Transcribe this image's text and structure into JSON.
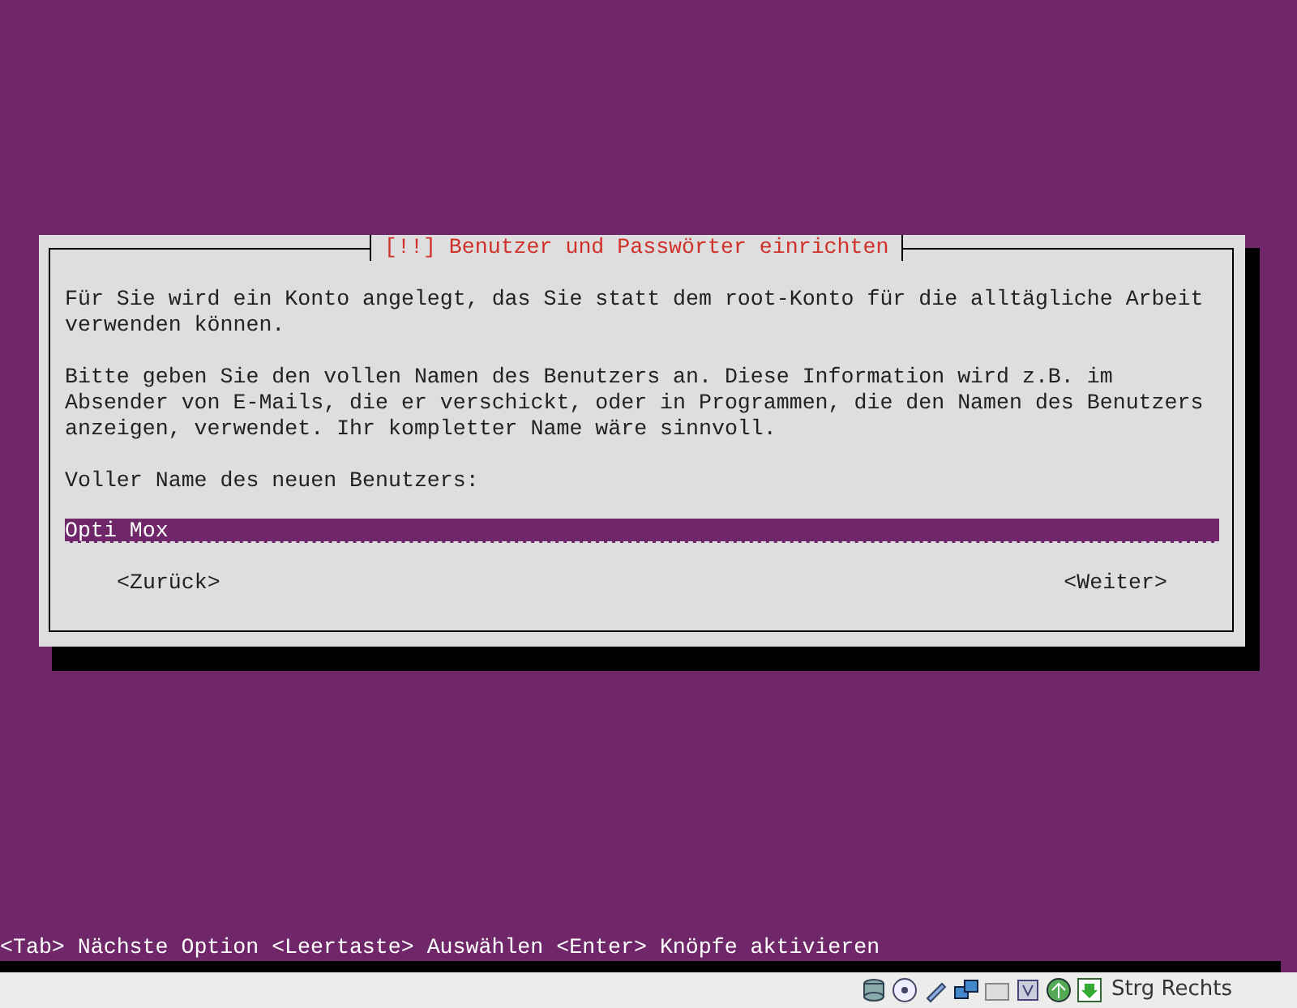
{
  "dialog": {
    "title": "[!!] Benutzer und Passwörter einrichten",
    "paragraphs": [
      "Für Sie wird ein Konto angelegt, das Sie statt dem root-Konto für die alltägliche Arbeit verwenden können.",
      "Bitte geben Sie den vollen Namen des Benutzers an. Diese Information wird z.B. im Absender von E-Mails, die er verschickt, oder in Programmen, die den Namen des Benutzers anzeigen, verwendet. Ihr kompletter Name wäre sinnvoll."
    ],
    "field": {
      "label": "Voller Name des neuen Benutzers:",
      "value": "Opti Mox"
    },
    "buttons": [
      {
        "label": "<Zurück>"
      },
      {
        "label": "<Weiter>"
      }
    ]
  },
  "hint": "<Tab> Nächste Option <Leertaste> Auswählen <Enter> Knöpfe aktivieren",
  "status_bar": {
    "host_key": "Strg Rechts"
  }
}
